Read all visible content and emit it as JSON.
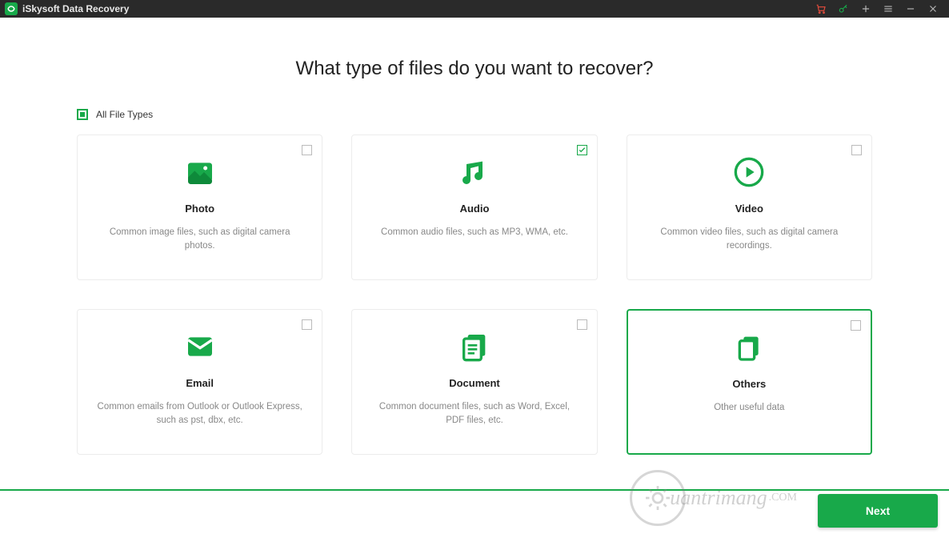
{
  "app": {
    "title": "iSkysoft Data Recovery"
  },
  "page": {
    "heading": "What type of files do you want to recover?",
    "all_label": "All File Types"
  },
  "cards": [
    {
      "title": "Photo",
      "desc": "Common image files, such as digital camera photos.",
      "checked": false,
      "selected": false,
      "icon": "photo"
    },
    {
      "title": "Audio",
      "desc": "Common audio files, such as MP3, WMA, etc.",
      "checked": true,
      "selected": false,
      "icon": "audio"
    },
    {
      "title": "Video",
      "desc": "Common video files, such as digital camera recordings.",
      "checked": false,
      "selected": false,
      "icon": "video"
    },
    {
      "title": "Email",
      "desc": "Common emails from Outlook or Outlook Express, such as pst, dbx, etc.",
      "checked": false,
      "selected": false,
      "icon": "email"
    },
    {
      "title": "Document",
      "desc": "Common document files, such as Word, Excel, PDF files, etc.",
      "checked": false,
      "selected": false,
      "icon": "document"
    },
    {
      "title": "Others",
      "desc": "Other useful data",
      "checked": false,
      "selected": true,
      "icon": "others"
    }
  ],
  "footer": {
    "next": "Next"
  },
  "watermark": "uantrimang"
}
